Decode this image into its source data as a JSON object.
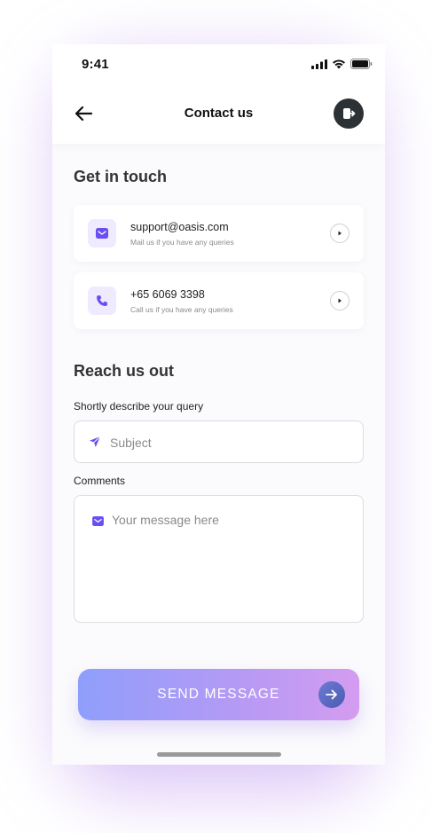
{
  "status_bar": {
    "time": "9:41"
  },
  "header": {
    "title": "Contact us"
  },
  "get_in_touch": {
    "title": "Get in touch",
    "contacts": [
      {
        "title": "support@oasis.com",
        "subtitle": "Mail us if you have any queries",
        "icon": "mail-icon"
      },
      {
        "title": "+65 6069 3398",
        "subtitle": "Call us if you have any queries",
        "icon": "phone-icon"
      }
    ]
  },
  "reach_us": {
    "title": "Reach us out",
    "query_label": "Shortly describe your query",
    "subject_placeholder": "Subject",
    "comments_label": "Comments",
    "message_placeholder": "Your message here"
  },
  "send_button": {
    "label": "SEND MESSAGE"
  },
  "colors": {
    "accent": "#6b4ef0",
    "dark": "#2b3134",
    "gradient_start": "#8f9efb",
    "gradient_end": "#d49cf0"
  }
}
